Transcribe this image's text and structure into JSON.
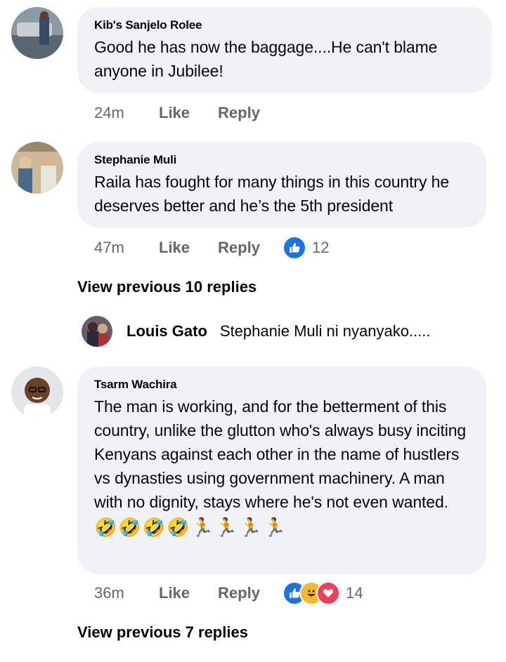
{
  "comments": [
    {
      "author": "Kib's Sanjelo Rolee",
      "text": "Good he has now the baggage....He can't blame anyone in Jubilee!",
      "time": "24m",
      "like": "Like",
      "reply": "Reply"
    },
    {
      "author": "Stephanie Muli",
      "text": "Raila has fought for many things in this country he deserves better and he’s the 5th president",
      "time": "47m",
      "like": "Like",
      "reply": "Reply",
      "reactions": "12"
    },
    {
      "author": "Tsarm Wachira",
      "text": "The man is working, and for the betterment of this country, unlike the glutton who's always busy inciting Kenyans against each other in the name of hustlers vs dynasties using government machinery. A man with no dignity, stays where he's not even wanted.",
      "emojis": "🤣🤣🤣🤣🏃🏃🏃🏃",
      "time": "36m",
      "like": "Like",
      "reply": "Reply",
      "reactions": "14"
    }
  ],
  "view_previous_1": "View previous 10 replies",
  "view_previous_2": "View previous 7 replies",
  "reply_preview": {
    "author": "Louis Gato",
    "text": "Stephanie Muli ni nyanyako....."
  },
  "icons": {
    "like": "thumbs-up-icon",
    "haha": "laugh-icon",
    "love": "heart-icon"
  },
  "colors": {
    "bubble": "#f0f2f5",
    "like_blue": "#1b74e4",
    "muted": "#65676b"
  }
}
